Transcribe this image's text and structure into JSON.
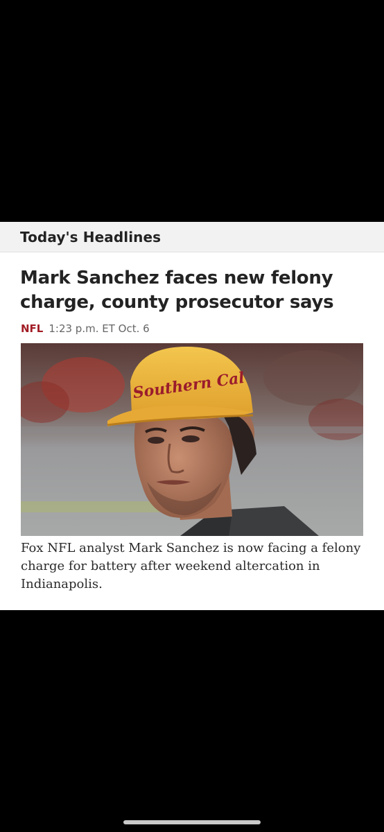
{
  "section": {
    "title": "Today's Headlines"
  },
  "article": {
    "headline": "Mark Sanchez faces new felony charge, county prosecutor says",
    "category": "NFL",
    "timestamp": "1:23 p.m. ET Oct. 6",
    "caption": "Fox NFL analyst Mark Sanchez is now facing a felony charge for battery after weekend altercation in Indianapolis.",
    "image": {
      "cap_text": "Southern Cal"
    }
  },
  "colors": {
    "section_tag": "#a11c24",
    "background": "#000000",
    "card": "#ffffff",
    "header_band": "#f2f2f2"
  },
  "icons": [
    "home-indicator"
  ]
}
